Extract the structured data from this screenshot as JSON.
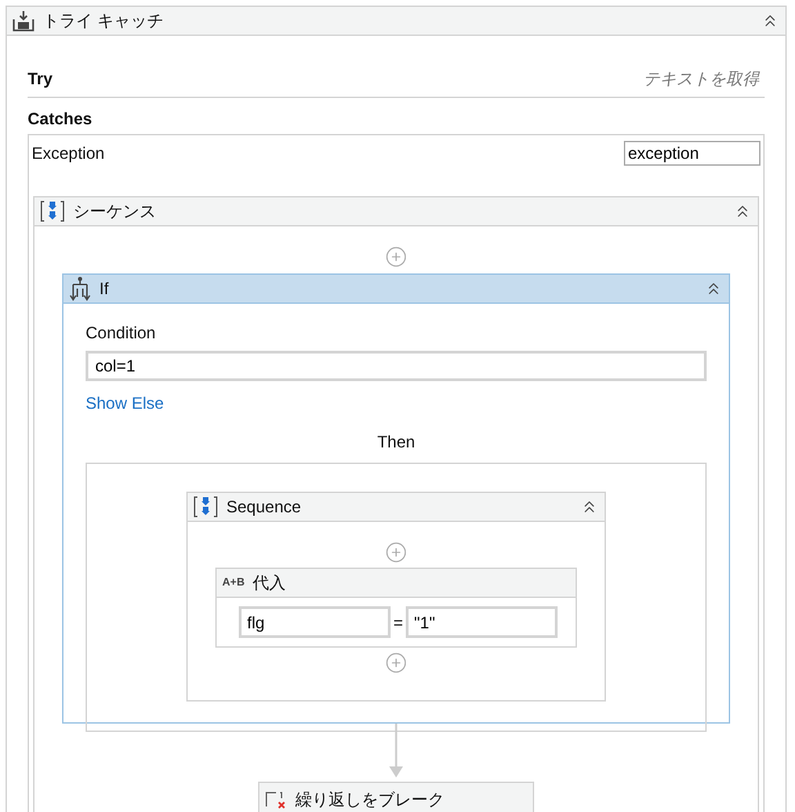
{
  "activity": {
    "title": "トライ キャッチ",
    "expanded": true
  },
  "try": {
    "label": "Try",
    "drop_hint": "テキストを取得"
  },
  "catches": {
    "label": "Catches",
    "exception_label": "Exception",
    "exception_value": "exception"
  },
  "sequence": {
    "title": "シーケンス",
    "expanded": true
  },
  "if": {
    "title": "If",
    "selected": true,
    "expanded": true,
    "condition_label": "Condition",
    "condition": "col=1",
    "show_else": "Show Else",
    "then_label": "Then"
  },
  "inner_sequence": {
    "title": "Sequence",
    "expanded": true
  },
  "assign": {
    "icon_label": "A+B",
    "title": "代入",
    "to": "flg",
    "operator": "=",
    "value": "\"1\""
  },
  "next_activity": {
    "title": "繰り返しをブレーク"
  }
}
